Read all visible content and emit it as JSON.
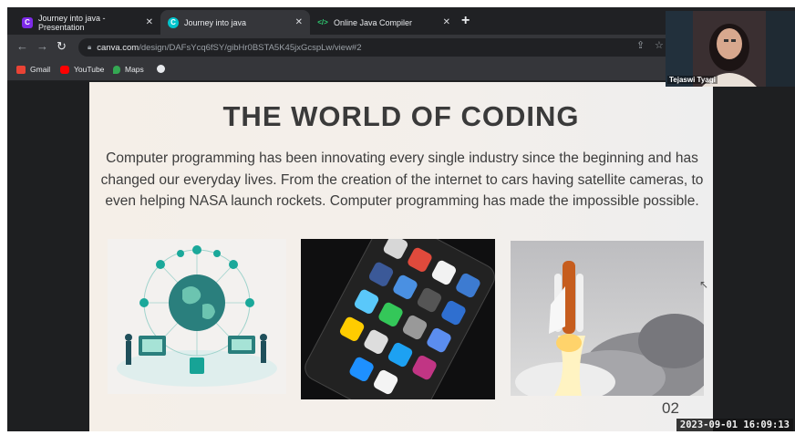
{
  "tabs": [
    {
      "title": "Journey into java - Presentation",
      "active": false,
      "favicon": "canva-icon",
      "color": "#7d2ae8"
    },
    {
      "title": "Journey into java",
      "active": true,
      "favicon": "canva-icon",
      "color": "#00c4cc"
    },
    {
      "title": "Online Java Compiler",
      "active": false,
      "favicon": "code-icon",
      "color": "#2ecc71"
    }
  ],
  "tab_close": "✕",
  "new_tab": "+",
  "address": {
    "host": "canva.com",
    "path": "/design/DAFsYcq6fSY/gibHr0BSTA5K45jxGcspLw/view#2"
  },
  "bookmarks": [
    "Gmail",
    "YouTube",
    "Maps"
  ],
  "slide": {
    "title": "THE WORLD OF CODING",
    "body": "Computer programming has been innovating every single industry since the beginning and has changed our everyday lives. From the creation of the internet to cars having satellite cameras, to even helping NASA launch rockets. Computer programming has made the impossible possible.",
    "page_number": "02"
  },
  "webcam": {
    "name": "Tejaswi Tyagi"
  },
  "timestamp": "2023-09-01 16:09:13"
}
